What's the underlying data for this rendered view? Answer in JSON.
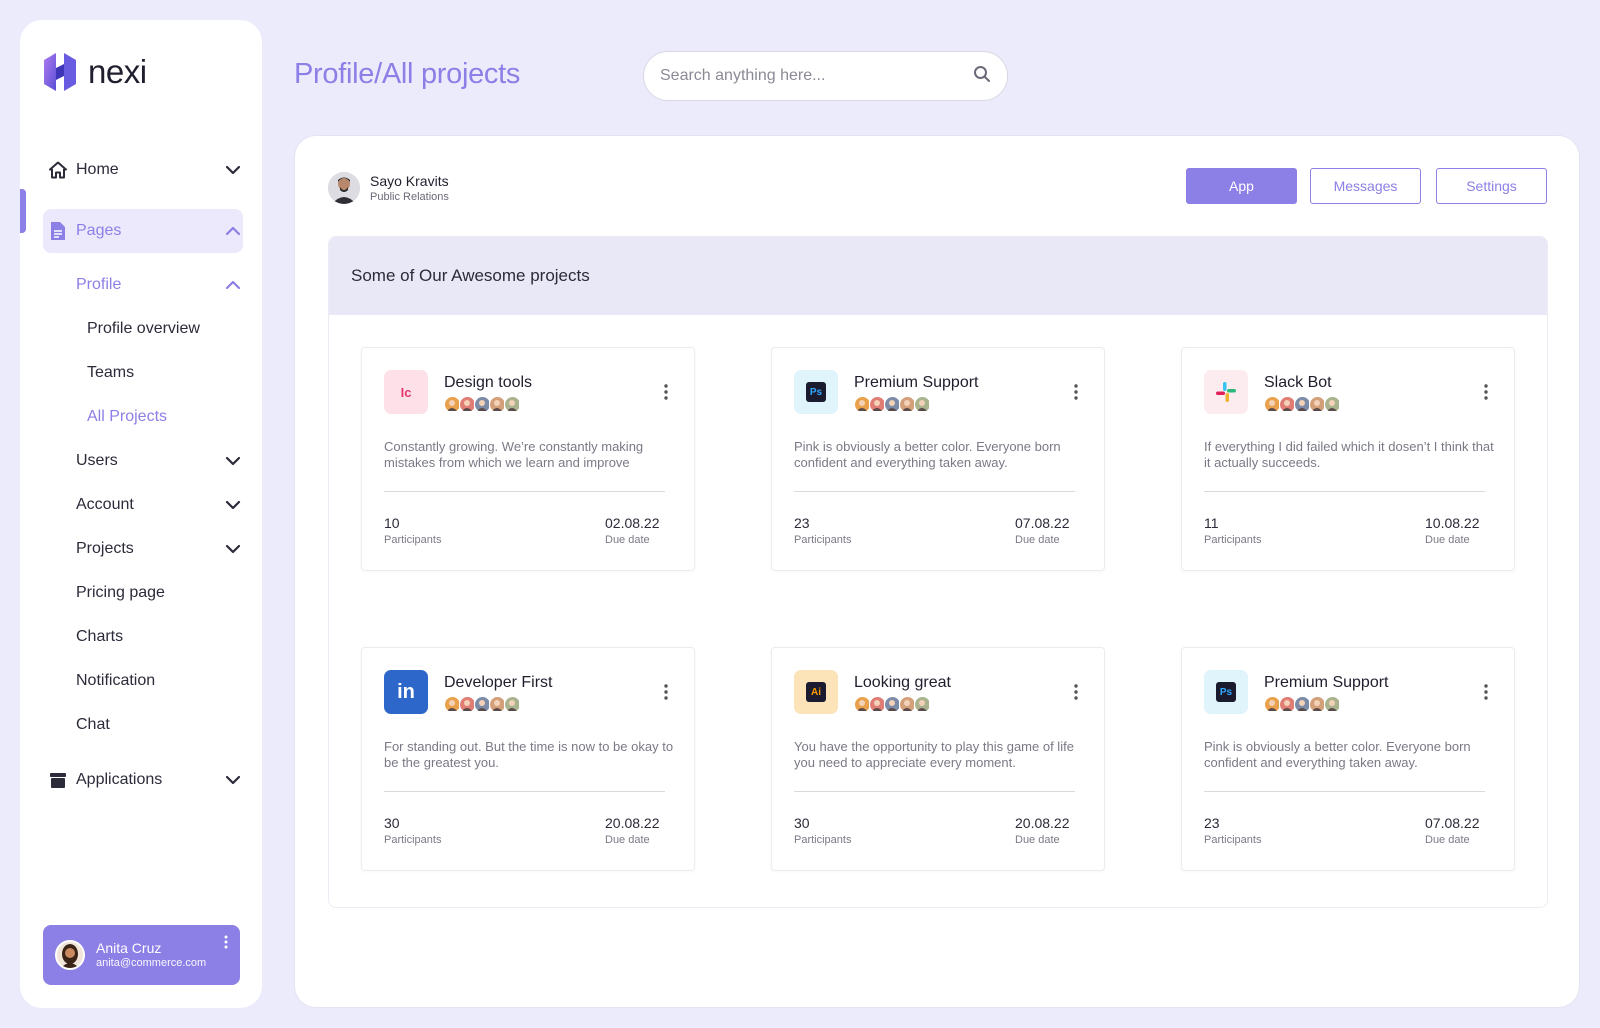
{
  "brand": {
    "name": "nexi"
  },
  "sidebar": {
    "home": {
      "label": "Home",
      "icon": "home-icon"
    },
    "pages": {
      "label": "Pages",
      "icon": "document-icon"
    },
    "profile": {
      "label": "Profile"
    },
    "profile_overview": {
      "label": "Profile overview"
    },
    "teams": {
      "label": "Teams"
    },
    "all_projects": {
      "label": "All Projects"
    },
    "users": {
      "label": "Users"
    },
    "account": {
      "label": "Account"
    },
    "projects": {
      "label": "Projects"
    },
    "pricing": {
      "label": "Pricing page"
    },
    "charts": {
      "label": "Charts"
    },
    "notification": {
      "label": "Notification"
    },
    "chat": {
      "label": "Chat"
    },
    "applications": {
      "label": "Applications",
      "icon": "archive-icon"
    }
  },
  "user": {
    "name": "Anita Cruz",
    "email": "anita@commerce.com"
  },
  "header": {
    "title": "Profile/All projects",
    "search_placeholder": "Search anything here..."
  },
  "owner": {
    "name": "Sayo Kravits",
    "role": "Public Relations"
  },
  "tabs": {
    "app": "App",
    "messages": "Messages",
    "settings": "Settings"
  },
  "projects_section": {
    "title": "Some of Our Awesome projects"
  },
  "labels": {
    "participants": "Participants",
    "due": "Due date"
  },
  "cards": [
    {
      "title": "Design tools",
      "desc": "Constantly growing. We’re constantly making mistakes from which we learn and improve",
      "participants": "10",
      "due": "02.08.22",
      "icon": "invision-icon",
      "icon_text": "Ic"
    },
    {
      "title": "Premium Support",
      "desc": "Pink is obviously a better color. Everyone born confident and everything taken away.",
      "participants": "23",
      "due": "07.08.22",
      "icon": "photoshop-icon",
      "icon_text": "Ps"
    },
    {
      "title": "Slack Bot",
      "desc": "If everything I did failed which it dosen’t I think that it actually succeeds.",
      "participants": "11",
      "due": "10.08.22",
      "icon": "slack-icon",
      "icon_text": ""
    },
    {
      "title": "Developer First",
      "desc": "For standing out. But the time is now to be okay to be the greatest you.",
      "participants": "30",
      "due": "20.08.22",
      "icon": "linkedin-icon",
      "icon_text": "in"
    },
    {
      "title": "Looking great",
      "desc": "You have the opportunity to play this game of life you need to appreciate every moment.",
      "participants": "30",
      "due": "20.08.22",
      "icon": "illustrator-icon",
      "icon_text": "Ai"
    },
    {
      "title": "Premium Support",
      "desc": "Pink is obviously a better color. Everyone born confident and everything taken away.",
      "participants": "23",
      "due": "07.08.22",
      "icon": "photoshop-icon",
      "icon_text": "Ps"
    }
  ],
  "colors": {
    "accent": "#8c7fe6",
    "background": "#ecebfb",
    "section_head": "#e9e8f7"
  }
}
